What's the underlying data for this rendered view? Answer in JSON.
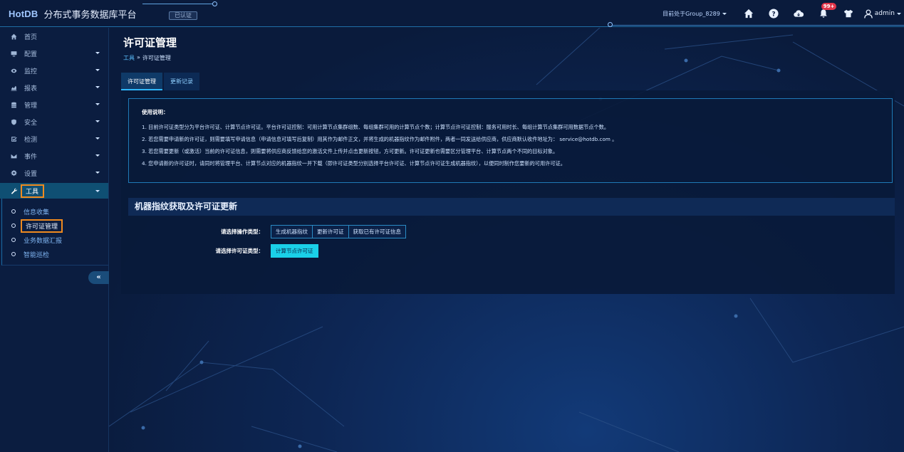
{
  "app": {
    "logo_mark": "HotDB",
    "title": "分布式事务数据库平台",
    "cert_status": "已认证"
  },
  "topbar": {
    "group_selector": "目前处于Group_8289",
    "notification_count": "99+",
    "user": "admin",
    "icons": [
      "home-icon",
      "help-icon",
      "cloud-icon",
      "bell-icon",
      "shirt-icon",
      "user-icon"
    ]
  },
  "sidebar": {
    "items": [
      {
        "label": "首页",
        "icon": "home-icon",
        "has_caret": false
      },
      {
        "label": "配置",
        "icon": "monitor-icon",
        "has_caret": true
      },
      {
        "label": "监控",
        "icon": "eye-icon",
        "has_caret": true
      },
      {
        "label": "报表",
        "icon": "chart-icon",
        "has_caret": true
      },
      {
        "label": "管理",
        "icon": "database-icon",
        "has_caret": true
      },
      {
        "label": "安全",
        "icon": "shield-icon",
        "has_caret": true
      },
      {
        "label": "检测",
        "icon": "checkbox-icon",
        "has_caret": true
      },
      {
        "label": "事件",
        "icon": "envelope-icon",
        "has_caret": true
      },
      {
        "label": "设置",
        "icon": "gear-icon",
        "has_caret": true
      },
      {
        "label": "工具",
        "icon": "wrench-icon",
        "has_caret": true
      }
    ],
    "sub_items": [
      "信息收集",
      "许可证管理",
      "业务数据汇报",
      "智能巡检"
    ],
    "collapse_label": "«"
  },
  "page": {
    "title": "许可证管理",
    "breadcrumb_parent": "工具",
    "breadcrumb_sep": "»",
    "breadcrumb_current": "许可证管理",
    "tabs": [
      "许可证管理",
      "更新记录"
    ]
  },
  "notice": {
    "title": "使用说明：",
    "lines": [
      "1. 目前许可证类型分为平台许可证、计算节点许可证。平台许可证控制：可用计算节点集群组数、每组集群可用的计算节点个数；计算节点许可证控制：服务可用时长、每组计算节点集群可用数据节点个数。",
      "2. 若您需要申请新的许可证，则需要填写申请信息（申请信息可填写后复制）用其作为邮件正文，并将生成的机器指纹作为邮件附件，两者一同发送给供应商，供应商默认收件地址为：  service@hotdb.com 。",
      "3. 若您需要更新（或激活）当前的许可证信息，则需要将供应商反馈给您的激活文件上传并点击更新按钮，方可更新。许可证更新也需要区分管理平台、计算节点两个不同的目标对象。",
      "4. 您申请新的许可证时，请同时将管理平台、计算节点对应的机器指纹一并下载（即许可证类型分别选择平台许可证、计算节点许可证生成机器指纹），以便同时制作您要新的可用许可证。"
    ]
  },
  "section": {
    "title": "机器指纹获取及许可证更新",
    "operation_label": "请选择操作类型：",
    "operations": [
      "生成机器指纹",
      "更新许可证",
      "获取已有许可证信息"
    ],
    "license_label": "请选择许可证类型：",
    "license_types": [
      "计算节点许可证"
    ]
  },
  "colors": {
    "accent": "#1ad0e8",
    "highlight_outline": "#ef8a1f",
    "badge": "#e0354a"
  }
}
